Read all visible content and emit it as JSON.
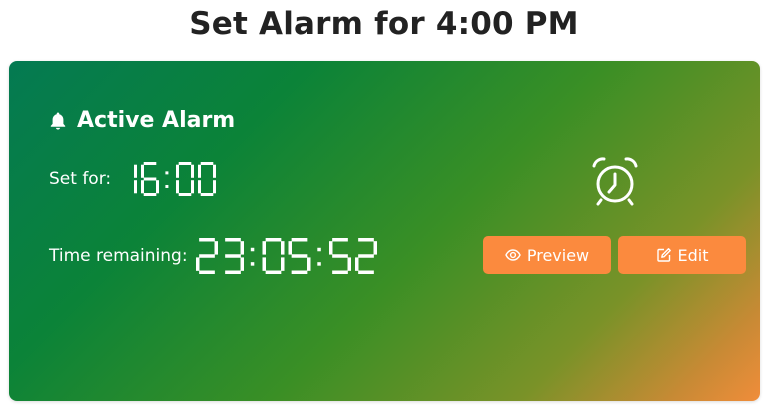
{
  "page": {
    "title": "Set Alarm for 4:00 PM"
  },
  "alarm": {
    "header": "Active Alarm",
    "set_for_label": "Set for:",
    "set_for_time": "16:00",
    "remaining_label": "Time remaining:",
    "remaining_time": "23:05:52"
  },
  "buttons": {
    "preview_label": "Preview",
    "edit_label": "Edit"
  },
  "icons": {
    "header": "bell-icon",
    "status": "alarm-clock-icon",
    "preview": "eye-icon",
    "edit": "edit-icon"
  },
  "colors": {
    "button": "#fb8a3e",
    "gradient_start": "#047a52",
    "gradient_end": "#f08d3a",
    "text": "#ffffff",
    "title": "#222222"
  }
}
